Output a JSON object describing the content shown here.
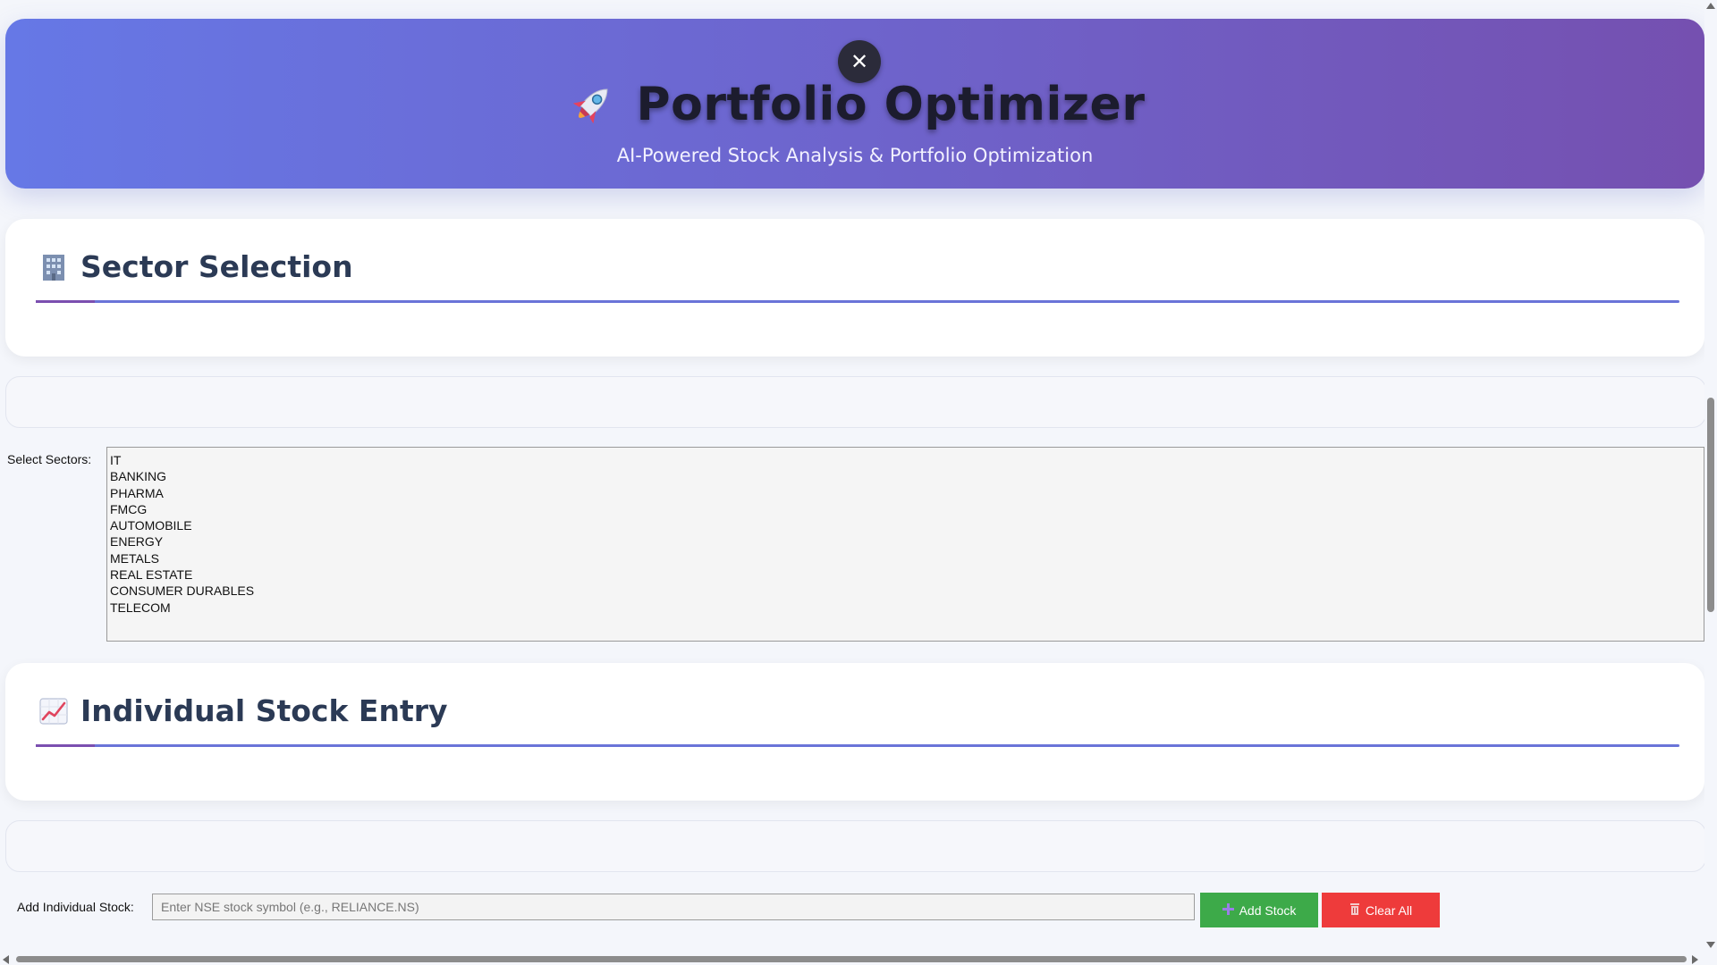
{
  "header": {
    "title": "Portfolio Optimizer",
    "subtitle": "AI-Powered Stock Analysis & Portfolio Optimization",
    "icon": "rocket-icon",
    "close_label": "✕"
  },
  "sector_section": {
    "title": "Sector Selection",
    "icon": "office-building-icon",
    "select_label": "Select Sectors:",
    "options": [
      "IT",
      "BANKING",
      "PHARMA",
      "FMCG",
      "AUTOMOBILE",
      "ENERGY",
      "METALS",
      "REAL ESTATE",
      "CONSUMER DURABLES",
      "TELECOM"
    ]
  },
  "stock_section": {
    "title": "Individual Stock Entry",
    "icon": "chart-increasing-icon",
    "input_label": "Add Individual Stock:",
    "input_placeholder": "Enter NSE stock symbol (e.g., RELIANCE.NS)",
    "input_value": "",
    "add_button_label": "Add Stock",
    "add_button_icon": "plus-icon",
    "clear_button_label": "Clear All",
    "clear_button_icon": "trash-icon"
  },
  "colors": {
    "header_gradient_start": "#6678e6",
    "header_gradient_end": "#7550b0",
    "accent_rule": "#6a74d8",
    "add_button": "#3daa49",
    "clear_button": "#ee3b3b"
  }
}
